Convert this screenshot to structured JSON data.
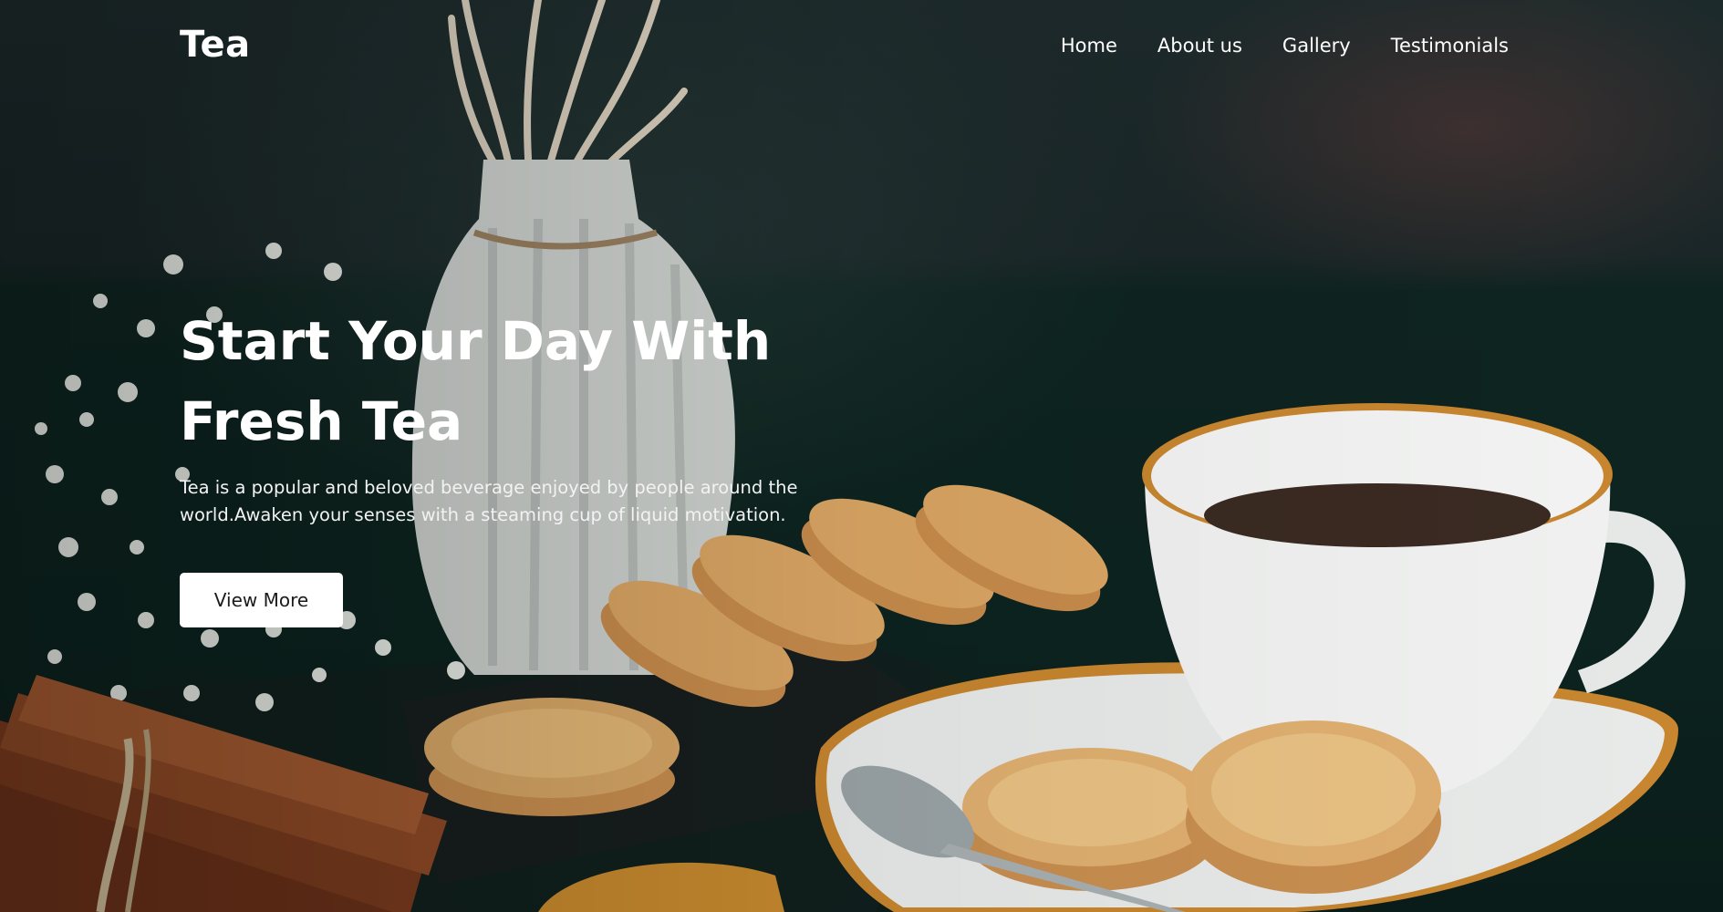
{
  "brand": {
    "logo": "Tea"
  },
  "nav": {
    "items": [
      "Home",
      "About us",
      "Gallery",
      "Testimonials"
    ]
  },
  "hero": {
    "headline_line1": "Start Your Day With",
    "headline_line2": "Fresh Tea",
    "description": "Tea is a popular and beloved beverage enjoyed by people around the world.Awaken your senses with a steaming cup of liquid motivation.",
    "cta_label": "View More",
    "background_icon": "tea-cup-cookies-photo"
  },
  "colors": {
    "background": "#0f1d1b",
    "accent_gold": "#c8862f",
    "button_bg": "#ffffff",
    "button_text": "#1b1b1b"
  }
}
